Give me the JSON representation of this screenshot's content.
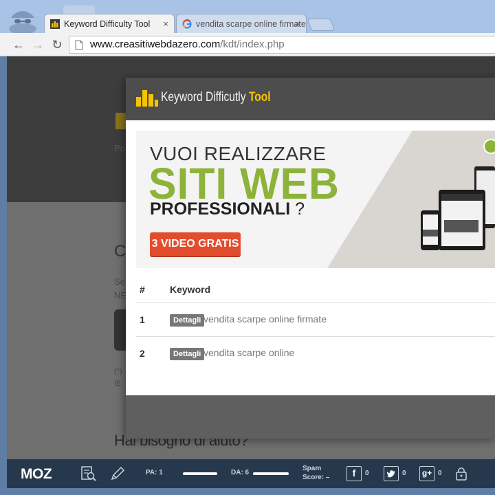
{
  "browser": {
    "tabs": [
      {
        "title": "Keyword Difficulty Tool",
        "active": true
      },
      {
        "title": "vendita scarpe online firmate",
        "active": false
      }
    ],
    "close_glyph": "×",
    "nav": {
      "back": "←",
      "forward": "→",
      "reload": "↻"
    },
    "url": {
      "host": "www.creasitiwebdazero.com",
      "path": "/kdt/index.php"
    }
  },
  "page_background": {
    "ghost_po": "Po",
    "ghost_c": "C",
    "ghost_se": "Se",
    "ghost_ne": "NE",
    "ghost_star": "(*)",
    "ghost_ie": "IE",
    "help_heading": "Hai bisogno di aiuto?"
  },
  "modal": {
    "title_main": "Keyword Difficutly",
    "title_accent": "Tool",
    "banner": {
      "line1": "VUOI REALIZZARE",
      "line2": "SITI WEB",
      "line3": "PROFESSIONALI",
      "line3_suffix": "?",
      "cta": "3 VIDEO GRATIS"
    },
    "table": {
      "col_num": "#",
      "col_keyword": "Keyword",
      "rows": [
        {
          "num": "1",
          "details": "Dettagli",
          "keyword": "vendita scarpe online firmate"
        },
        {
          "num": "2",
          "details": "Dettagli",
          "keyword": "vendita scarpe online"
        }
      ]
    }
  },
  "mozbar": {
    "logo": "MOZ",
    "pa_label": "PA: 1",
    "da_label": "DA: 6",
    "spam_line1": "Spam",
    "spam_line2": "Score:",
    "spam_value": "–",
    "facebook": {
      "glyph": "f",
      "count": "0"
    },
    "twitter": {
      "count": "0"
    },
    "gplus": {
      "glyph": "g+",
      "count": "0"
    }
  },
  "colors": {
    "accent_yellow": "#f5c400",
    "banner_green": "#8db33a",
    "cta_red": "#e24d2e",
    "mozbar_bg": "#26394c"
  }
}
